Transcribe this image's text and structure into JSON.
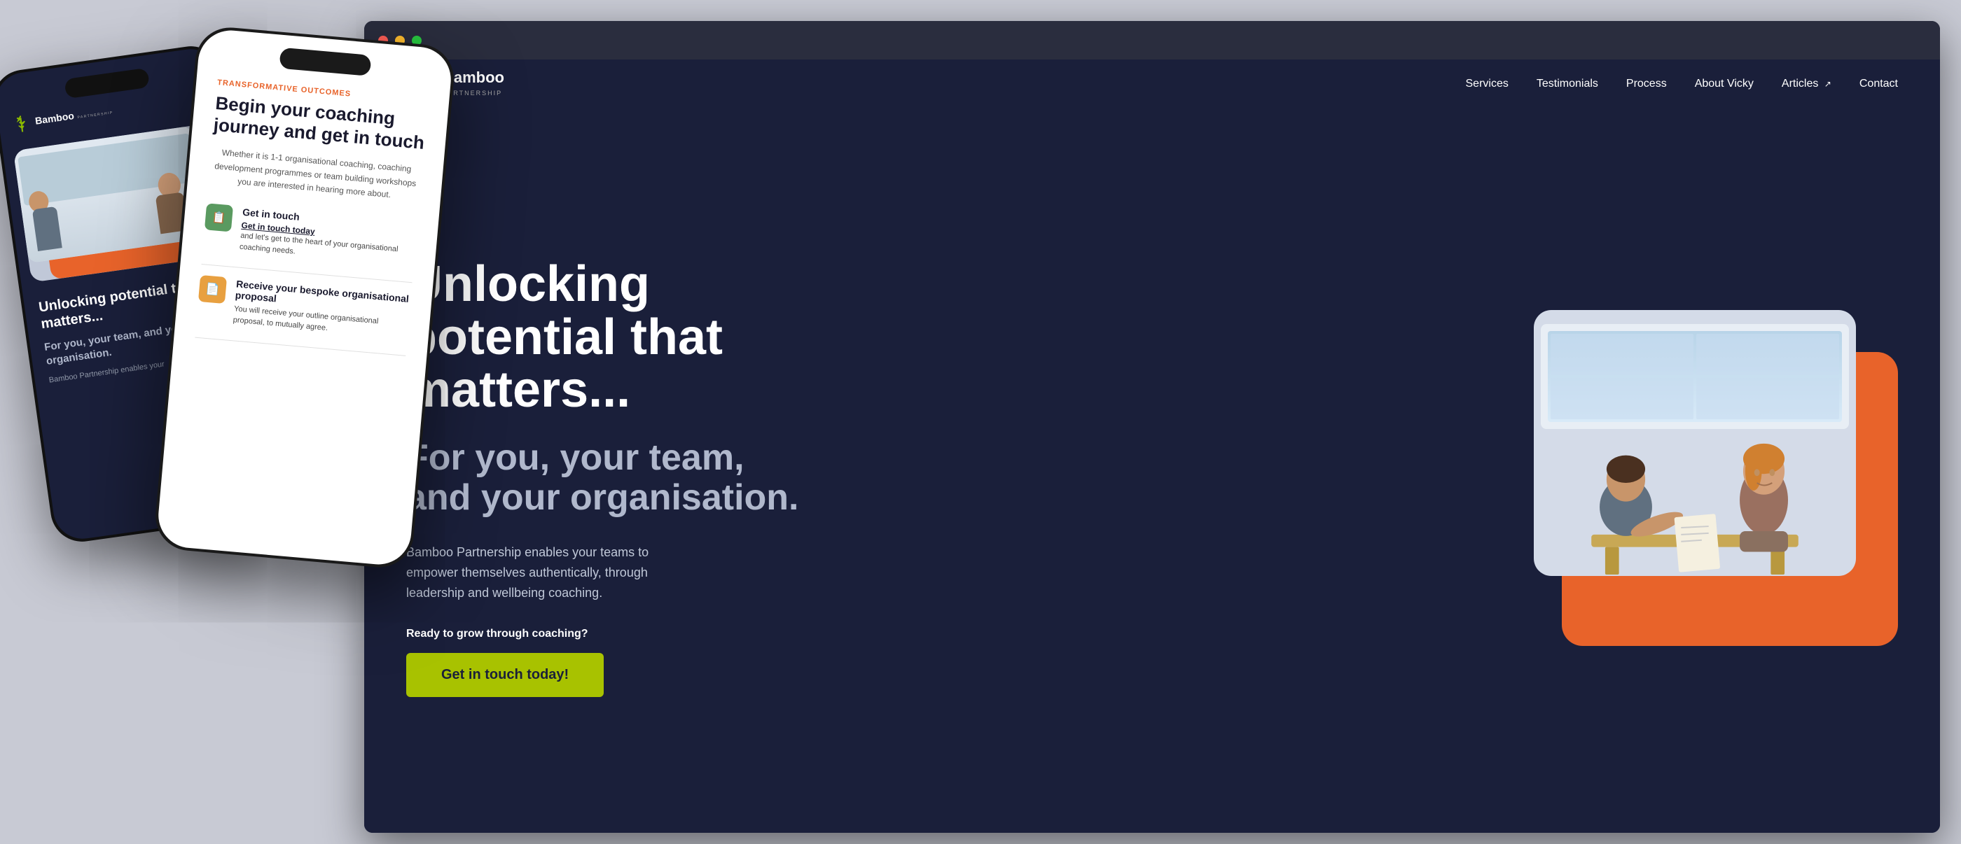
{
  "background": {
    "color": "#c8cad4"
  },
  "browser": {
    "dots": [
      "red",
      "yellow",
      "green"
    ]
  },
  "site": {
    "logo": {
      "name": "Bamboo",
      "sub": "PARTNERSHIP",
      "icon_color": "#8ab800"
    },
    "nav": {
      "links": [
        "Services",
        "Testimonials",
        "Process",
        "About Vicky",
        "Articles",
        "Contact"
      ],
      "articles_external": true
    },
    "hero": {
      "title": "Unlocking potential that matters...",
      "subtitle": "For you, your team, and your organisation.",
      "description": "Bamboo Partnership enables your teams to empower themselves authentically, through leadership and wellbeing coaching.",
      "cta_prompt": "Ready to grow through coaching?",
      "cta_button": "Get in touch today!"
    }
  },
  "phone_left": {
    "nav": {
      "brand_name": "Bamboo",
      "brand_sub": "PARTNERSHIP"
    },
    "content": {
      "title": "Unlocking potential that matters...",
      "subtitle": "For you, your team, and your organisation.",
      "description": "Bamboo Partnership enables your"
    }
  },
  "phone_center": {
    "eyebrow": "TRANSFORMATIVE OUTCOMES",
    "title": "Begin your coaching journey and get in touch",
    "description": "Whether it is 1-1 organisational coaching, coaching development programmes or team building workshops you are interested in hearing more about.",
    "steps": [
      {
        "icon": "📋",
        "icon_bg": "green",
        "title": "Get in touch",
        "link": "Get in touch today",
        "text": "and let's get to the heart of your organisational coaching needs."
      },
      {
        "icon": "📄",
        "icon_bg": "orange",
        "title": "Receive your bespoke organisational proposal",
        "link": "",
        "text": "You will receive your outline organisational proposal, to mutually agree."
      }
    ]
  }
}
